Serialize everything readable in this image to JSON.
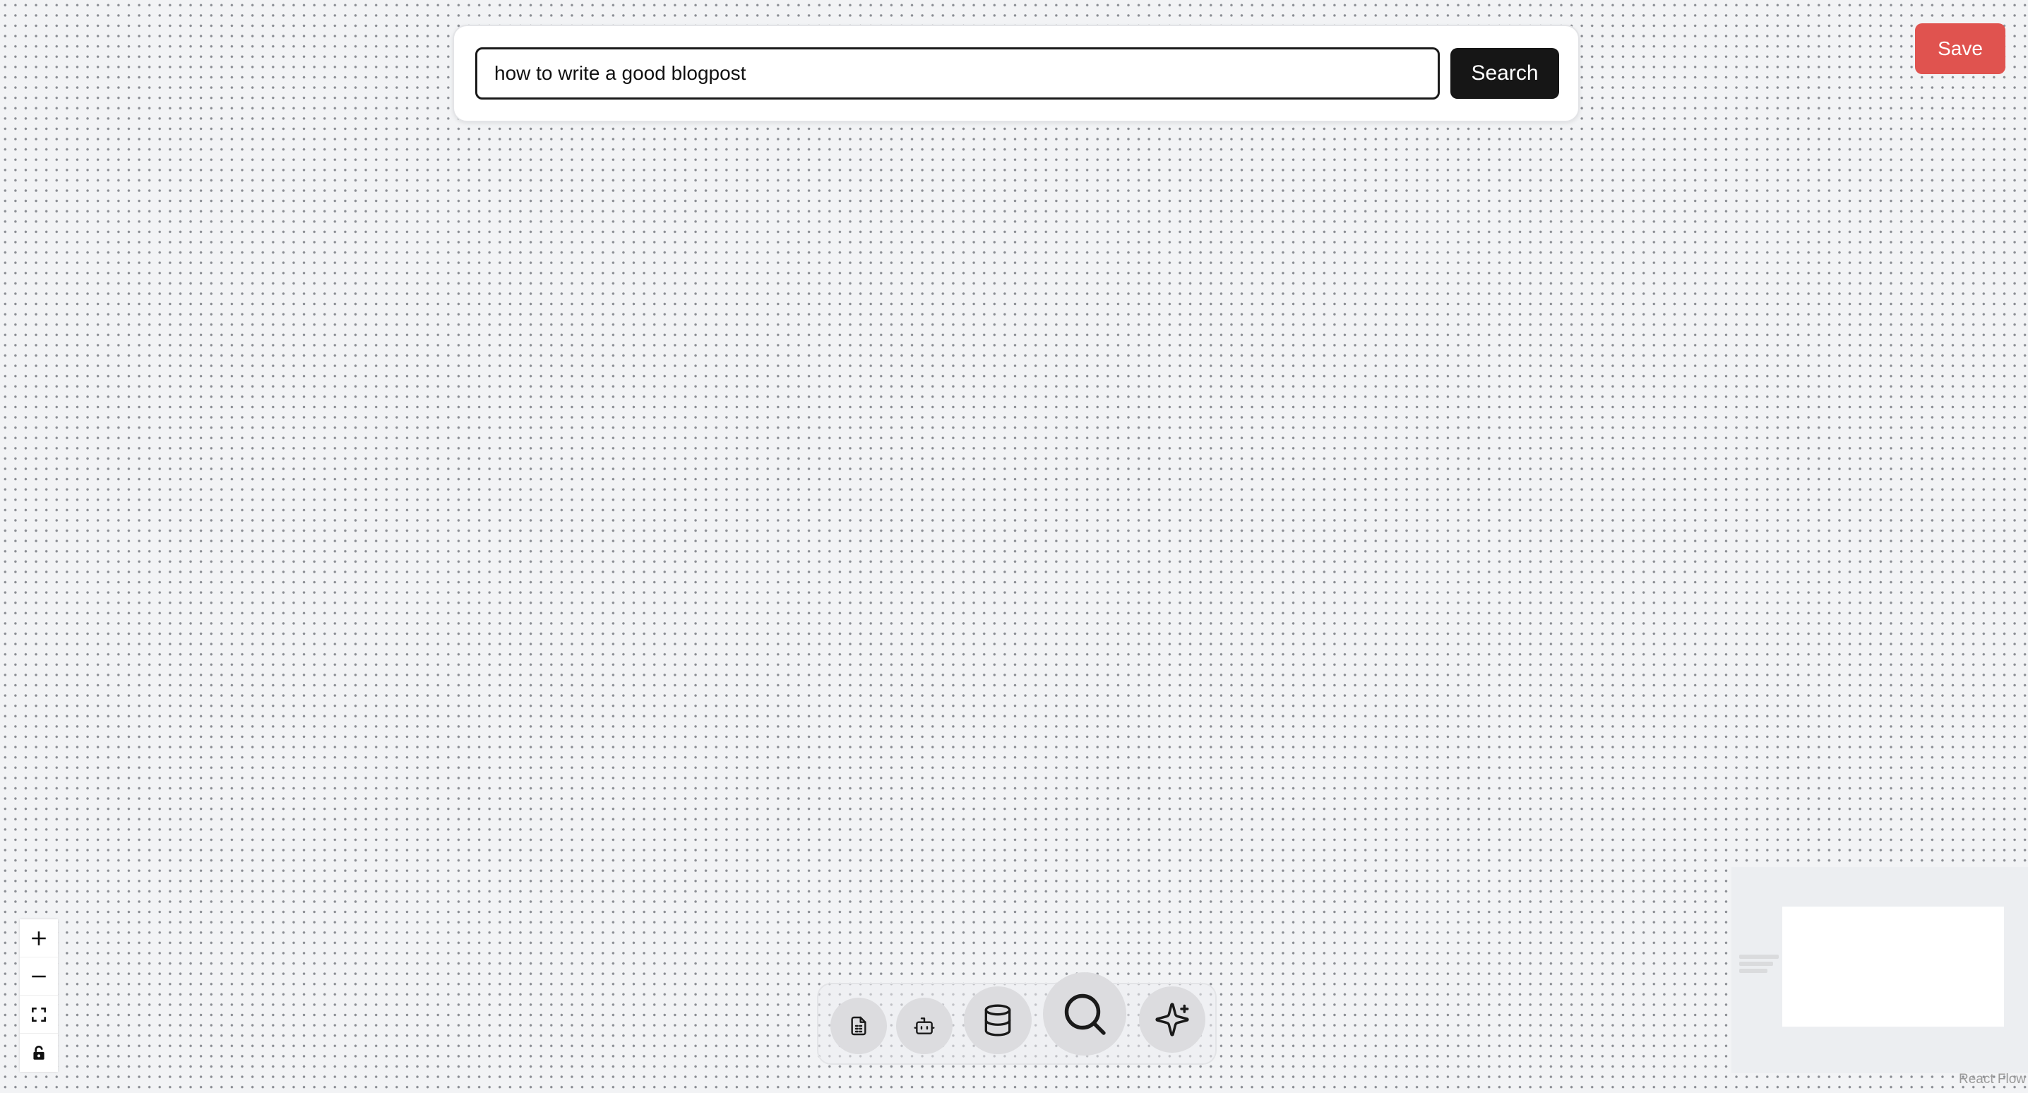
{
  "search": {
    "query": "how to write a good blogpost",
    "button_label": "Search"
  },
  "header": {
    "save_label": "Save"
  },
  "colors": {
    "save_button": "#e0534f",
    "search_button": "#161616",
    "canvas_background": "#f2f3f5"
  },
  "zoom_controls": {
    "items": [
      {
        "name": "zoom-in",
        "icon": "plus-icon"
      },
      {
        "name": "zoom-out",
        "icon": "minus-icon"
      },
      {
        "name": "fit-view",
        "icon": "fit-view-icon"
      },
      {
        "name": "toggle-interactivity",
        "icon": "lock-icon"
      }
    ]
  },
  "toolbar": {
    "tools": [
      {
        "name": "document",
        "icon": "document-icon"
      },
      {
        "name": "bot",
        "icon": "bot-icon"
      },
      {
        "name": "database",
        "icon": "database-icon"
      },
      {
        "name": "search",
        "icon": "search-icon"
      },
      {
        "name": "sparkles",
        "icon": "sparkles-icon"
      }
    ]
  },
  "attribution": {
    "text": "React Flow"
  }
}
